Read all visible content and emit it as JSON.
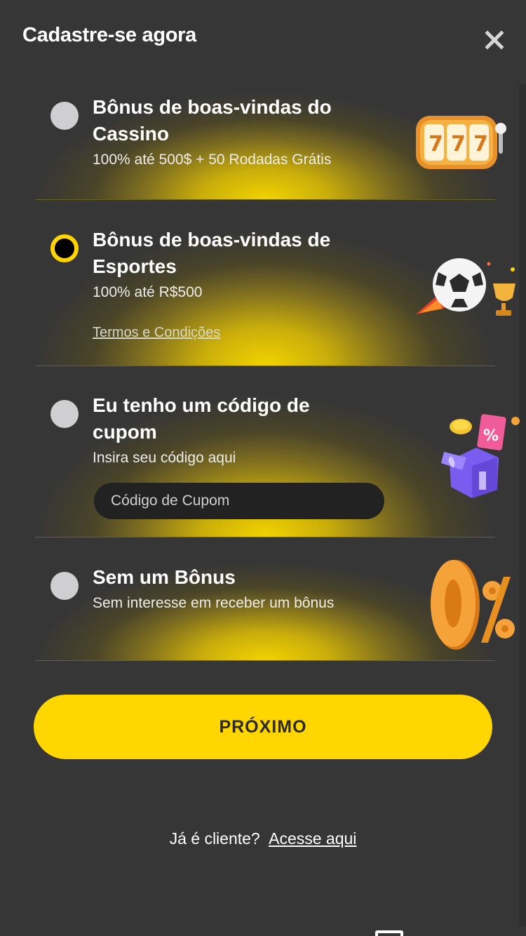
{
  "header": {
    "title": "Cadastre-se agora",
    "close_label": "X"
  },
  "options": [
    {
      "title": "Bônus de boas-vindas do Cassino",
      "subtitle": "100% até 500$ + 50 Rodadas Grátis",
      "selected": false,
      "icon": "slot-machine-icon"
    },
    {
      "title": "Bônus de boas-vindas de Esportes",
      "subtitle": "100% até R$500",
      "terms": "Termos e Condições",
      "selected": true,
      "icon": "soccer-trophy-icon"
    },
    {
      "title": "Eu tenho um código de cupom",
      "subtitle": "Insira seu código aqui",
      "input_placeholder": "Código de Cupom",
      "input_value": "",
      "selected": false,
      "icon": "gift-box-icon"
    },
    {
      "title": "Sem um Bônus",
      "subtitle": "Sem interesse em receber um bônus",
      "selected": false,
      "icon": "zero-percent-icon"
    }
  ],
  "next_button": "PRÓXIMO",
  "login": {
    "prompt": "Já é cliente?",
    "link": "Acesse aqui"
  },
  "colors": {
    "background": "#363636",
    "accent": "#ffd600",
    "radio": "#cfcfd1"
  }
}
